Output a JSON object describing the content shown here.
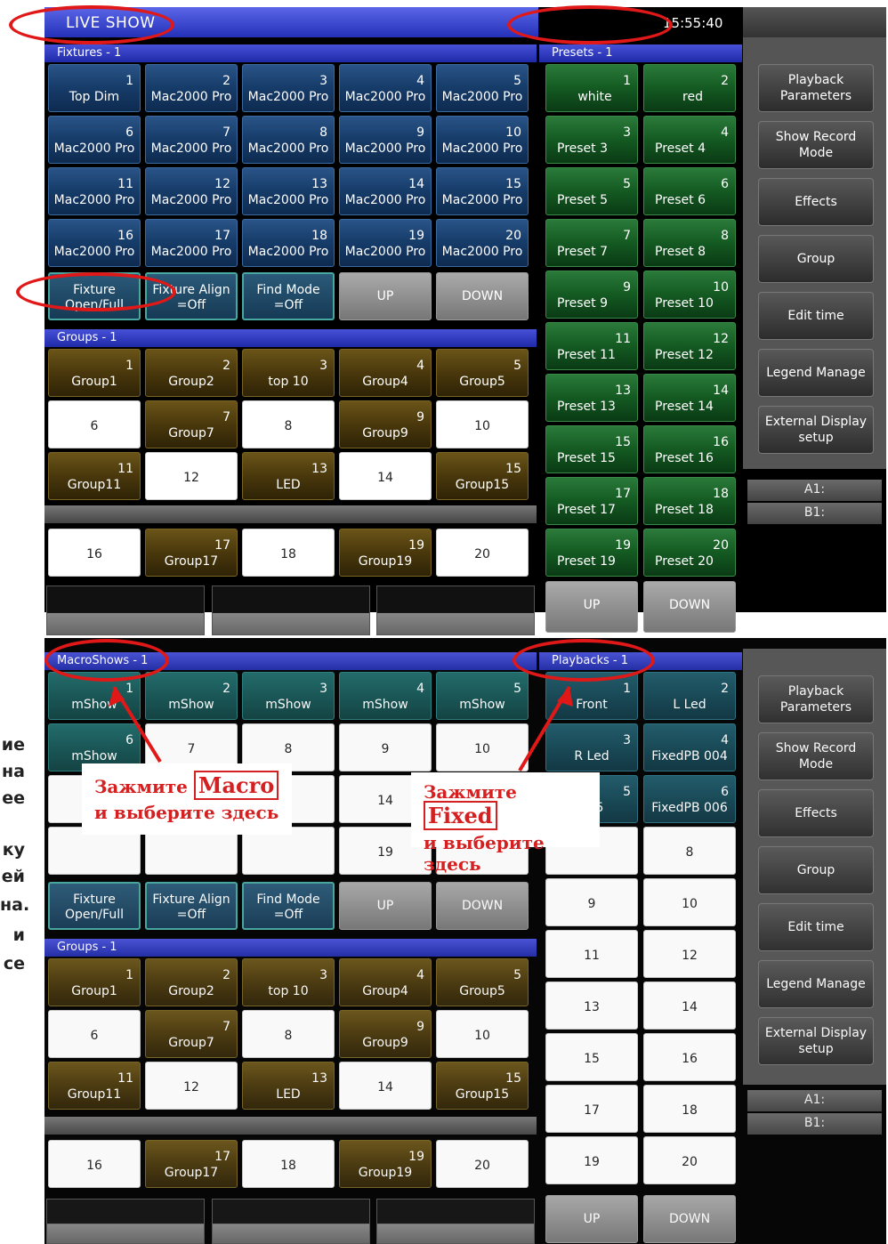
{
  "screen1": {
    "title": "LIVE SHOW",
    "clock": "15:55:40",
    "fixtures_header": "Fixtures - 1",
    "presets_header": "Presets - 1",
    "groups_header": "Groups - 1",
    "fixtures": [
      {
        "n": "1",
        "l": "Top Dim"
      },
      {
        "n": "2",
        "l": "Mac2000 Pro"
      },
      {
        "n": "3",
        "l": "Mac2000 Pro"
      },
      {
        "n": "4",
        "l": "Mac2000 Pro"
      },
      {
        "n": "5",
        "l": "Mac2000 Pro"
      },
      {
        "n": "6",
        "l": "Mac2000 Pro"
      },
      {
        "n": "7",
        "l": "Mac2000 Pro"
      },
      {
        "n": "8",
        "l": "Mac2000 Pro"
      },
      {
        "n": "9",
        "l": "Mac2000 Pro"
      },
      {
        "n": "10",
        "l": "Mac2000 Pro"
      },
      {
        "n": "11",
        "l": "Mac2000 Pro"
      },
      {
        "n": "12",
        "l": "Mac2000 Pro"
      },
      {
        "n": "13",
        "l": "Mac2000 Pro"
      },
      {
        "n": "14",
        "l": "Mac2000 Pro"
      },
      {
        "n": "15",
        "l": "Mac2000 Pro"
      },
      {
        "n": "16",
        "l": "Mac2000 Pro"
      },
      {
        "n": "17",
        "l": "Mac2000 Pro"
      },
      {
        "n": "18",
        "l": "Mac2000 Pro"
      },
      {
        "n": "19",
        "l": "Mac2000 Pro"
      },
      {
        "n": "20",
        "l": "Mac2000 Pro"
      }
    ],
    "controls": {
      "fixture": "Fixture Open/Full",
      "align": "Fixture Align =Off",
      "find": "Find Mode =Off",
      "up": "UP",
      "down": "DOWN"
    },
    "groups": [
      {
        "n": "1",
        "l": "Group1",
        "t": "brown"
      },
      {
        "n": "2",
        "l": "Group2",
        "t": "brown"
      },
      {
        "n": "3",
        "l": "top 10",
        "t": "brown"
      },
      {
        "n": "4",
        "l": "Group4",
        "t": "brown"
      },
      {
        "n": "5",
        "l": "Group5",
        "t": "brown"
      },
      {
        "n": "",
        "l": "6",
        "t": "white"
      },
      {
        "n": "7",
        "l": "Group7",
        "t": "brown"
      },
      {
        "n": "",
        "l": "8",
        "t": "white"
      },
      {
        "n": "9",
        "l": "Group9",
        "t": "brown"
      },
      {
        "n": "",
        "l": "10",
        "t": "white"
      },
      {
        "n": "11",
        "l": "Group11",
        "t": "brown"
      },
      {
        "n": "",
        "l": "12",
        "t": "white"
      },
      {
        "n": "13",
        "l": "LED",
        "t": "brown"
      },
      {
        "n": "",
        "l": "14",
        "t": "white"
      },
      {
        "n": "15",
        "l": "Group15",
        "t": "brown"
      },
      {
        "n": "",
        "l": "16",
        "t": "white"
      },
      {
        "n": "17",
        "l": "Group17",
        "t": "brown"
      },
      {
        "n": "",
        "l": "18",
        "t": "white"
      },
      {
        "n": "19",
        "l": "Group19",
        "t": "brown"
      },
      {
        "n": "",
        "l": "20",
        "t": "white"
      }
    ],
    "presets": [
      {
        "n": "1",
        "l": "white"
      },
      {
        "n": "2",
        "l": "red"
      },
      {
        "n": "3",
        "l": "Preset 3"
      },
      {
        "n": "4",
        "l": "Preset 4"
      },
      {
        "n": "5",
        "l": "Preset 5"
      },
      {
        "n": "6",
        "l": "Preset 6"
      },
      {
        "n": "7",
        "l": "Preset 7"
      },
      {
        "n": "8",
        "l": "Preset 8"
      },
      {
        "n": "9",
        "l": "Preset 9"
      },
      {
        "n": "10",
        "l": "Preset 10"
      },
      {
        "n": "11",
        "l": "Preset 11"
      },
      {
        "n": "12",
        "l": "Preset 12"
      },
      {
        "n": "13",
        "l": "Preset 13"
      },
      {
        "n": "14",
        "l": "Preset 14"
      },
      {
        "n": "15",
        "l": "Preset 15"
      },
      {
        "n": "16",
        "l": "Preset 16"
      },
      {
        "n": "17",
        "l": "Preset 17"
      },
      {
        "n": "18",
        "l": "Preset 18"
      },
      {
        "n": "19",
        "l": "Preset 19"
      },
      {
        "n": "20",
        "l": "Preset 20"
      }
    ],
    "preset_up": "UP",
    "preset_down": "DOWN",
    "right": [
      "Playback Parameters",
      "Show Record Mode",
      "Effects",
      "Group",
      "Edit time",
      "Legend Manage",
      "External Display setup"
    ],
    "a1": "A1:",
    "b1": "B1:"
  },
  "screen2": {
    "macro_header": "MacroShows - 1",
    "playbacks_header": "Playbacks - 1",
    "groups_header": "Groups - 1",
    "macros": [
      {
        "n": "1",
        "l": "mShow",
        "t": "teal2"
      },
      {
        "n": "2",
        "l": "mShow",
        "t": "teal2"
      },
      {
        "n": "3",
        "l": "mShow",
        "t": "teal2"
      },
      {
        "n": "4",
        "l": "mShow",
        "t": "teal2"
      },
      {
        "n": "5",
        "l": "mShow",
        "t": "teal2"
      },
      {
        "n": "6",
        "l": "mShow",
        "t": "teal2"
      },
      {
        "n": "",
        "l": "7",
        "t": "white"
      },
      {
        "n": "",
        "l": "8",
        "t": "white"
      },
      {
        "n": "",
        "l": "9",
        "t": "white"
      },
      {
        "n": "",
        "l": "10",
        "t": "white"
      },
      {
        "n": "",
        "l": "",
        "t": "white"
      },
      {
        "n": "",
        "l": "",
        "t": "white"
      },
      {
        "n": "",
        "l": "",
        "t": "white"
      },
      {
        "n": "",
        "l": "14",
        "t": "white"
      },
      {
        "n": "",
        "l": "",
        "t": "white"
      },
      {
        "n": "",
        "l": "",
        "t": "white"
      },
      {
        "n": "",
        "l": "",
        "t": "white"
      },
      {
        "n": "",
        "l": "",
        "t": "white"
      },
      {
        "n": "",
        "l": "19",
        "t": "white"
      },
      {
        "n": "",
        "l": "",
        "t": "white"
      }
    ],
    "controls": {
      "fixture": "Fixture Open/Full",
      "align": "Fixture Align =Off",
      "find": "Find Mode =Off",
      "up": "UP",
      "down": "DOWN"
    },
    "playbacks": [
      {
        "n": "1",
        "l": "Front",
        "t": "pb"
      },
      {
        "n": "2",
        "l": "L Led",
        "t": "pb"
      },
      {
        "n": "3",
        "l": "R Led",
        "t": "pb"
      },
      {
        "n": "4",
        "l": "FixedPB 004",
        "t": "pb"
      },
      {
        "n": "5",
        "l": "005",
        "t": "pb"
      },
      {
        "n": "6",
        "l": "FixedPB 006",
        "t": "pb"
      },
      {
        "n": "",
        "l": "",
        "t": "white"
      },
      {
        "n": "",
        "l": "8",
        "t": "white"
      },
      {
        "n": "",
        "l": "9",
        "t": "white"
      },
      {
        "n": "",
        "l": "10",
        "t": "white"
      },
      {
        "n": "",
        "l": "11",
        "t": "white"
      },
      {
        "n": "",
        "l": "12",
        "t": "white"
      },
      {
        "n": "",
        "l": "13",
        "t": "white"
      },
      {
        "n": "",
        "l": "14",
        "t": "white"
      },
      {
        "n": "",
        "l": "15",
        "t": "white"
      },
      {
        "n": "",
        "l": "16",
        "t": "white"
      },
      {
        "n": "",
        "l": "17",
        "t": "white"
      },
      {
        "n": "",
        "l": "18",
        "t": "white"
      },
      {
        "n": "",
        "l": "19",
        "t": "white"
      },
      {
        "n": "",
        "l": "20",
        "t": "white"
      }
    ],
    "pb_up": "UP",
    "pb_down": "DOWN",
    "right": [
      "Playback Parameters",
      "Show Record Mode",
      "Effects",
      "Group",
      "Edit time",
      "Legend Manage",
      "External Display setup"
    ],
    "a1": "A1:",
    "b1": "B1:"
  },
  "callouts": {
    "macro_pre": "Зажмите",
    "macro_word": "Macro",
    "macro_post": "и выберите здесь",
    "fixed_pre": "Зажмите",
    "fixed_word": "Fixed",
    "fixed_post": "и выберите здесь"
  },
  "left_fragments": [
    "ие",
    "на",
    "ее",
    "ку",
    "ей",
    "на.",
    "и",
    "се"
  ]
}
